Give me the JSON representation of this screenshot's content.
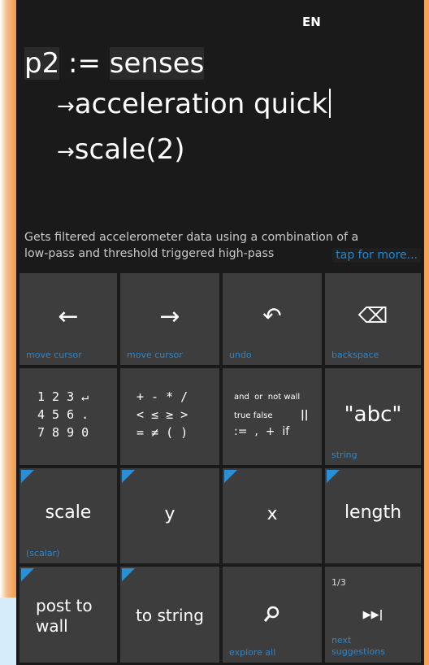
{
  "status": {
    "language": "EN"
  },
  "code": {
    "line1": {
      "var": "p2",
      "op": ":=",
      "value": "senses"
    },
    "line2": {
      "arrow": "→",
      "text": "acceleration quick"
    },
    "line3": {
      "arrow": "→",
      "text": "scale",
      "arg": "(2)"
    }
  },
  "description": {
    "line1": "Gets filtered accelerometer data using a combination of a",
    "line2": "low-pass and threshold triggered high-pass",
    "more": "tap for more..."
  },
  "keys": {
    "row1": [
      {
        "glyph": "←",
        "caption": "move cursor"
      },
      {
        "glyph": "→",
        "caption": "move cursor"
      },
      {
        "glyph": "↶",
        "caption": "undo"
      },
      {
        "glyph": "⌫",
        "caption": "backspace"
      }
    ],
    "numbers": {
      "l1": "1 2 3 ↵",
      "l2": "4 5 6 .",
      "l3": "7 8 9 0"
    },
    "operators": {
      "l1": "+ - * /",
      "l2": "< ≤ ≥ >",
      "l3": "= ≠ ( )"
    },
    "words": {
      "l1": "and  or  not wall",
      "l2a": "true false",
      "l2b": "||",
      "l3": ":=  ,  +  if"
    },
    "string": {
      "label": "\"abc\"",
      "caption": "string"
    },
    "row3": [
      {
        "label": "scale",
        "caption": "(scalar)"
      },
      {
        "label": "y",
        "caption": ""
      },
      {
        "label": "x",
        "caption": ""
      },
      {
        "label": "length",
        "caption": ""
      }
    ],
    "row4": {
      "post_a": "post to",
      "post_b": "wall",
      "tostring": "to string",
      "explore": "explore all",
      "page": "1/3",
      "next_a": "next",
      "next_b": "suggestions"
    }
  }
}
